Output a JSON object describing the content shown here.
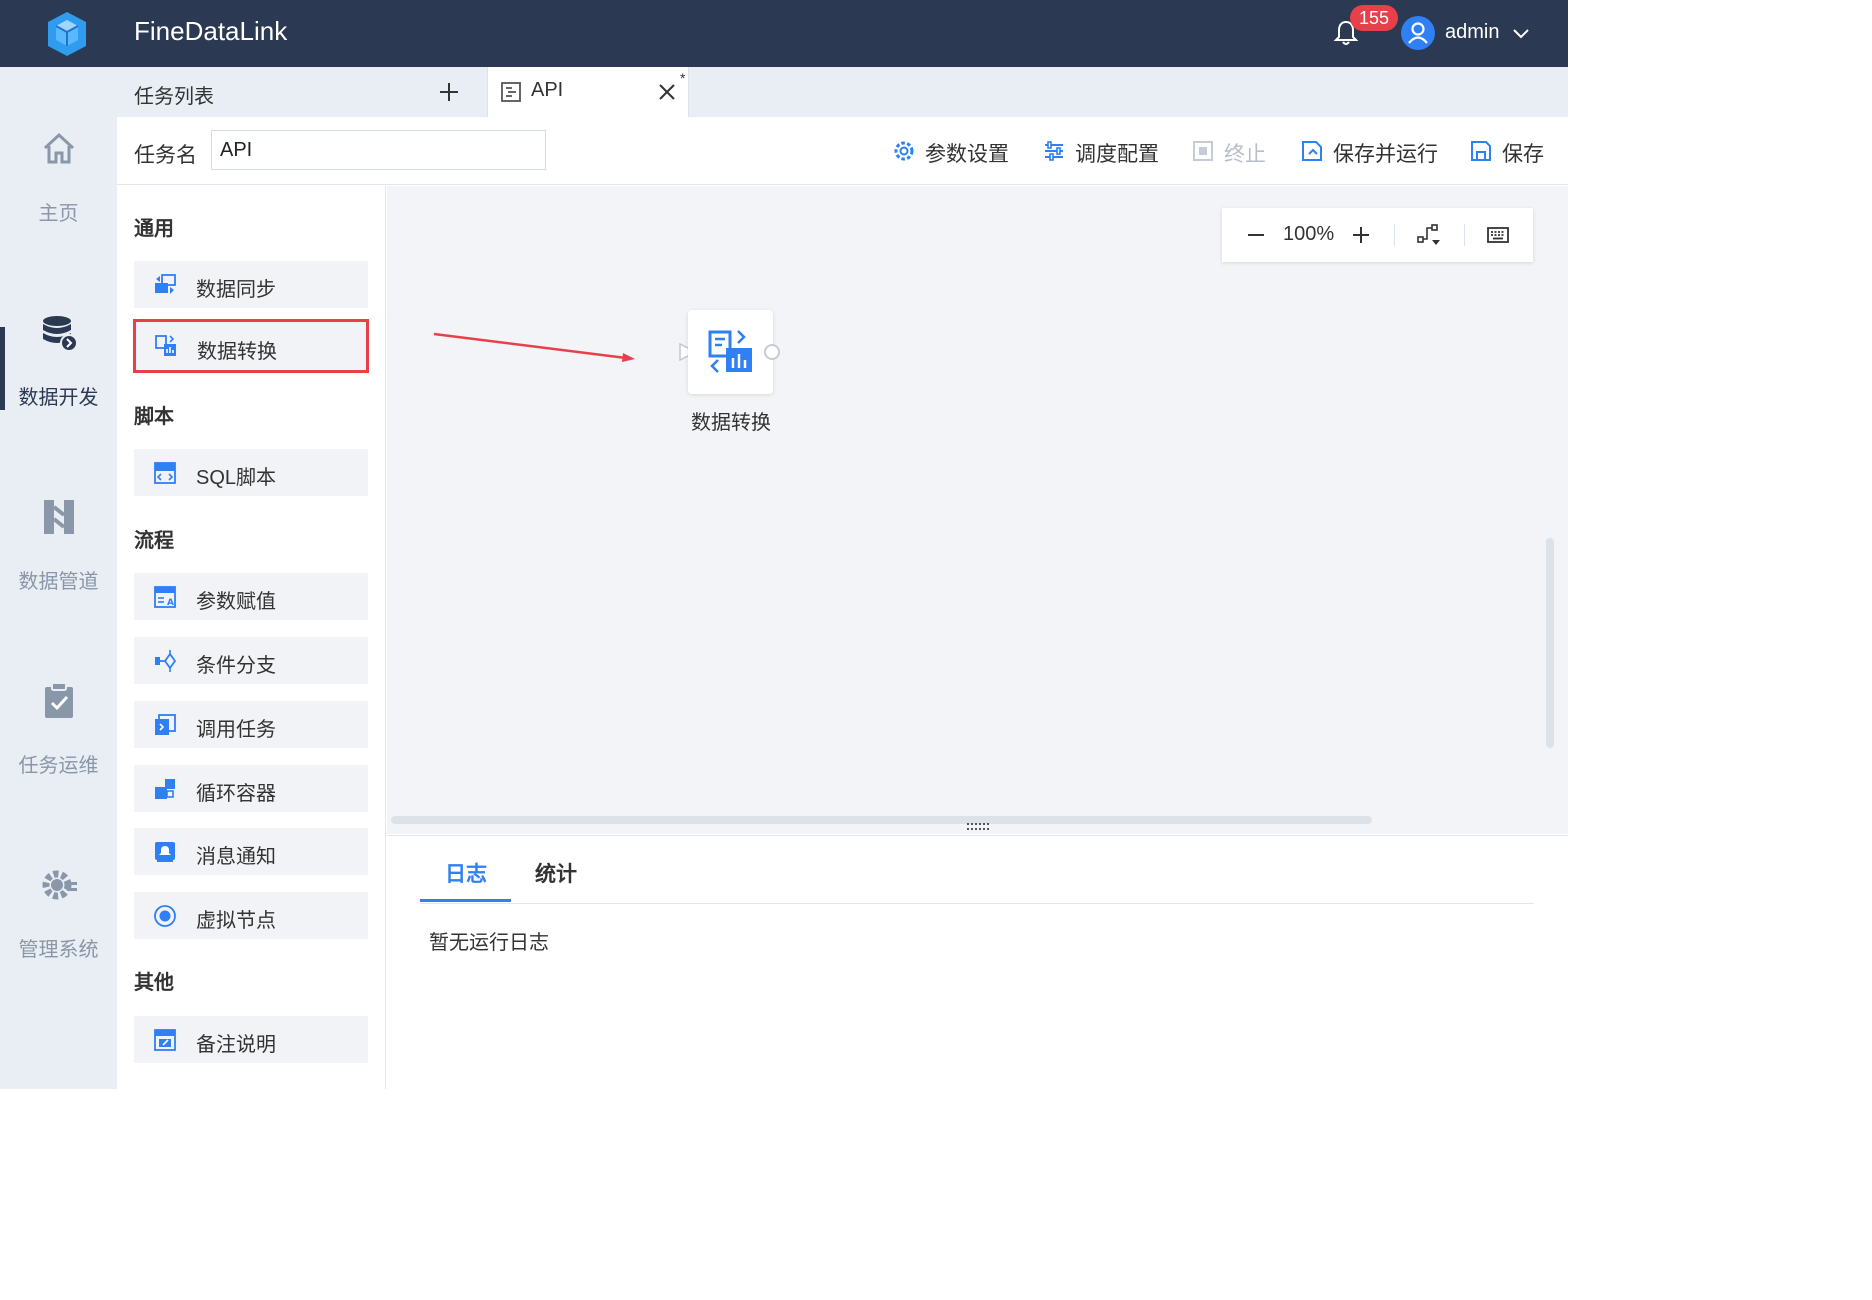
{
  "app": {
    "title": "FineDataLink"
  },
  "header": {
    "notification_count": "155",
    "username": "admin"
  },
  "leftnav": {
    "items": [
      {
        "label": "主页",
        "icon": "home-icon"
      },
      {
        "label": "数据开发",
        "icon": "database-icon",
        "active": true
      },
      {
        "label": "数据管道",
        "icon": "pipeline-icon"
      },
      {
        "label": "任务运维",
        "icon": "clipboard-check-icon"
      },
      {
        "label": "管理系统",
        "icon": "gear-icon"
      }
    ]
  },
  "tabs": {
    "list_label": "任务列表",
    "active_tab": {
      "label": "API",
      "modified_marker": "*"
    }
  },
  "toolbar": {
    "task_name_label": "任务名",
    "task_name_value": "API",
    "buttons": {
      "params": "参数设置",
      "schedule": "调度配置",
      "stop": "终止",
      "save_run": "保存并运行",
      "save": "保存"
    }
  },
  "palette": {
    "groups": [
      {
        "title": "通用",
        "items": [
          "数据同步",
          "数据转换"
        ]
      },
      {
        "title": "脚本",
        "items": [
          "SQL脚本"
        ]
      },
      {
        "title": "流程",
        "items": [
          "参数赋值",
          "条件分支",
          "调用任务",
          "循环容器",
          "消息通知",
          "虚拟节点"
        ]
      },
      {
        "title": "其他",
        "items": [
          "备注说明"
        ]
      }
    ]
  },
  "canvas": {
    "zoom": "100%",
    "node": {
      "label": "数据转换"
    }
  },
  "logpanel": {
    "tabs": [
      "日志",
      "统计"
    ],
    "empty_text": "暂无运行日志"
  },
  "colors": {
    "header_bg": "#2b3a52",
    "accent": "#2f7ff5",
    "badge": "#e8404a",
    "highlight_border": "#e8404a"
  }
}
